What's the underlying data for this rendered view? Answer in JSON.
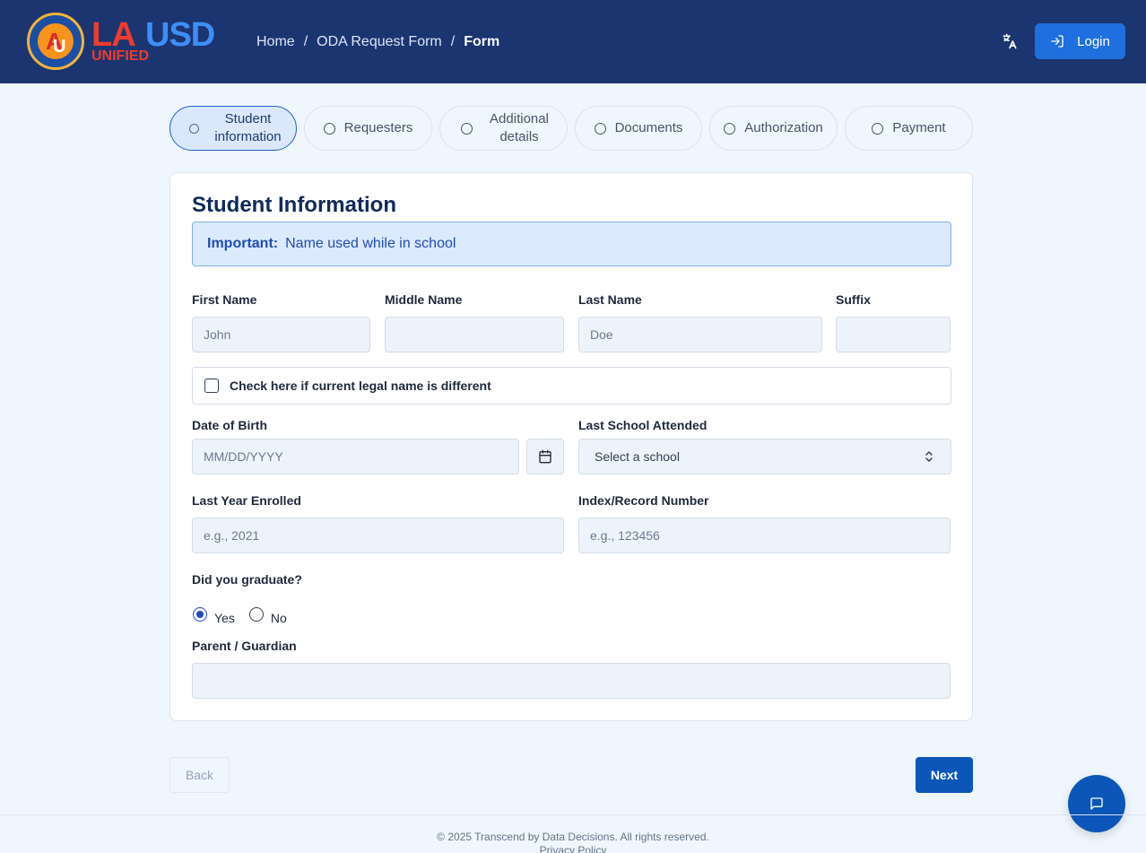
{
  "header": {
    "logo": {
      "text_la": "LA",
      "text_usd": "USD",
      "text_unified": "UNIFIED"
    },
    "breadcrumb": [
      "Home",
      "ODA Request Form",
      "Form"
    ],
    "language_icon": "translate-icon",
    "login_label": "Login",
    "login_icon": "login-arrow-icon"
  },
  "stepper": [
    {
      "label": "Student information",
      "active": true
    },
    {
      "label": "Requesters",
      "active": false
    },
    {
      "label": "Additional details",
      "active": false
    },
    {
      "label": "Documents",
      "active": false
    },
    {
      "label": "Authorization",
      "active": false
    },
    {
      "label": "Payment",
      "active": false
    }
  ],
  "form": {
    "title": "Student Information",
    "notice_strong": "Important:",
    "notice_text": "Name used while in school",
    "first_name": {
      "label": "First Name",
      "placeholder": "John"
    },
    "middle_name": {
      "label": "Middle Name",
      "placeholder": ""
    },
    "last_name": {
      "label": "Last Name",
      "placeholder": "Doe"
    },
    "suffix": {
      "label": "Suffix",
      "placeholder": ""
    },
    "legal_name_checkbox": "Check here if current legal name is different",
    "dob": {
      "label": "Date of Birth",
      "placeholder": "MM/DD/YYYY"
    },
    "last_school": {
      "label": "Last School Attended",
      "value": "Select a school"
    },
    "last_year": {
      "label": "Last Year Enrolled",
      "placeholder": "e.g., 2021"
    },
    "index_number": {
      "label": "Index/Record Number",
      "placeholder": "e.g., 123456"
    },
    "graduated": {
      "label": "Did you graduate?",
      "options": [
        "Yes",
        "No"
      ],
      "selected": "Yes"
    },
    "parent": {
      "label": "Parent / Guardian",
      "placeholder": ""
    }
  },
  "nav": {
    "back_label": "Back",
    "next_label": "Next"
  },
  "chat_icon": "chat-bubble-icon",
  "footer": {
    "copyright": "© 2025 Transcend by Data Decisions. All rights reserved.",
    "privacy": "Privacy Policy"
  },
  "colors": {
    "header_bg": "#1b3570",
    "primary": "#0b56b8",
    "login_button": "#1f6fde",
    "page_bg": "#eff6fd",
    "notice_bg": "#dbeafe"
  }
}
